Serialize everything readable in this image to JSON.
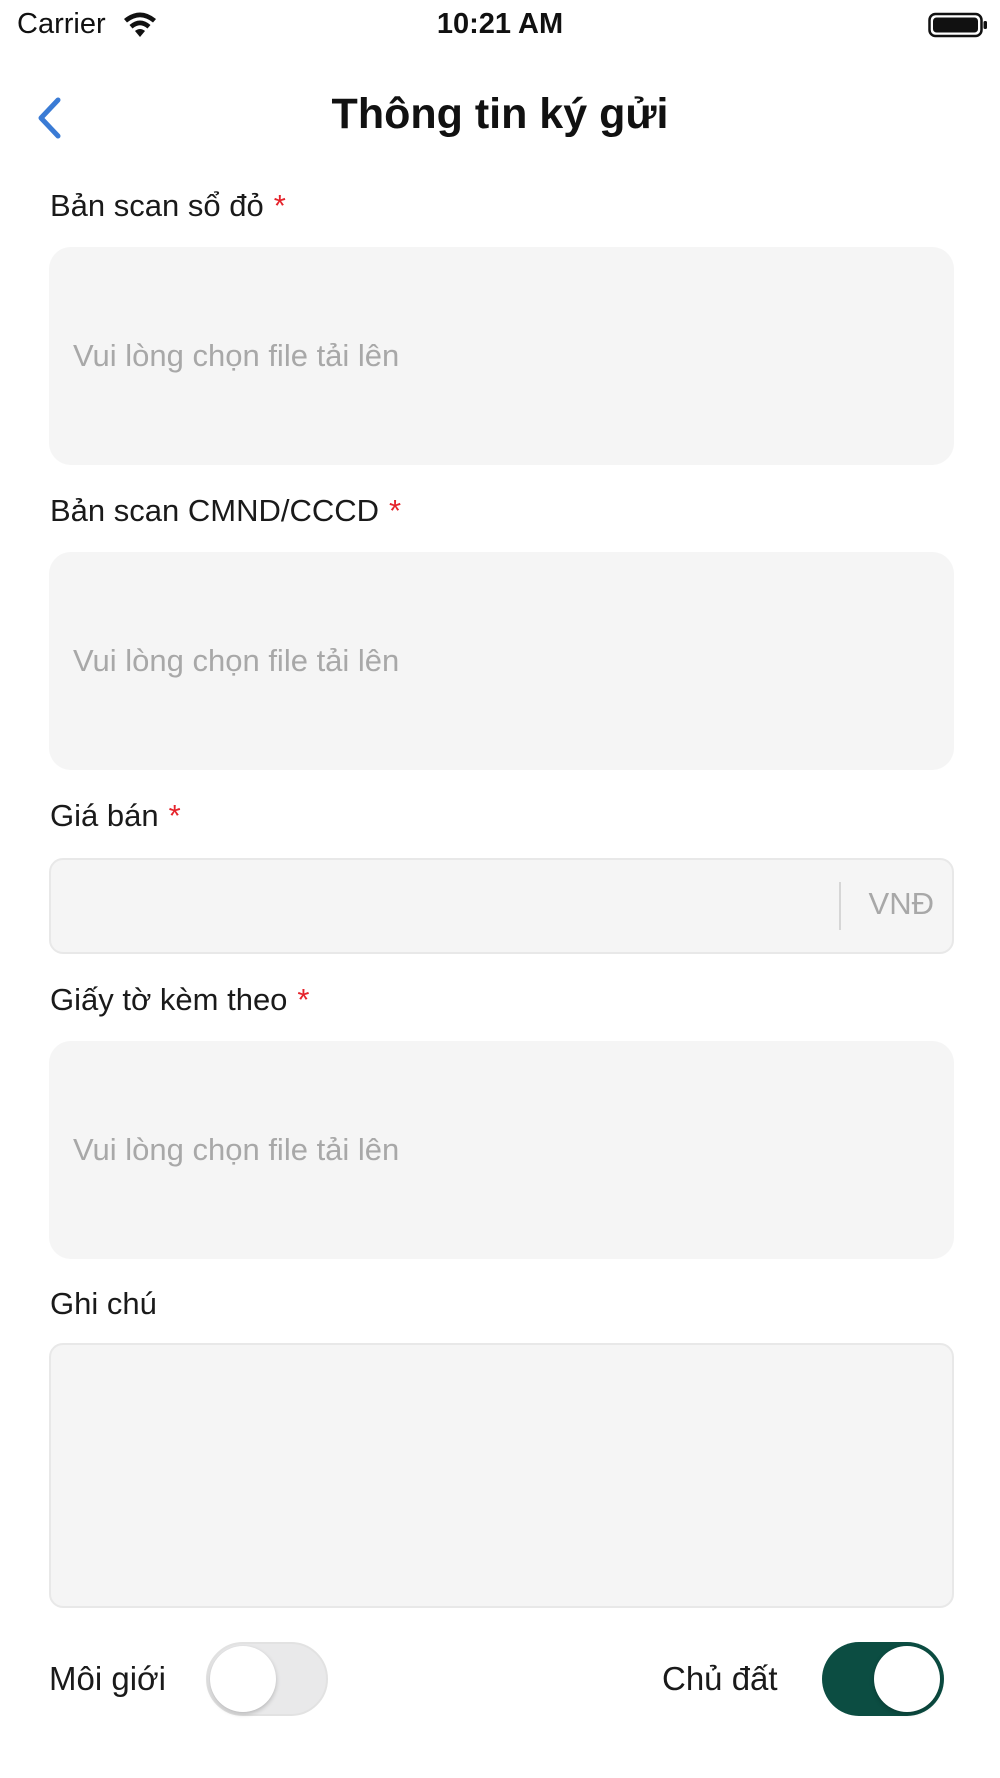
{
  "status_bar": {
    "carrier": "Carrier",
    "time": "10:21 AM"
  },
  "nav": {
    "title": "Thông tin ký gửi",
    "back_icon": "chevron-left-icon",
    "accent_color": "#3a7bd5"
  },
  "form": {
    "red_book_scan": {
      "label": "Bản scan sổ đỏ",
      "required_mark": "*",
      "placeholder": "Vui lòng chọn file tải lên"
    },
    "id_card_scan": {
      "label": "Bản scan CMND/CCCD",
      "required_mark": "*",
      "placeholder": "Vui lòng chọn file tải lên"
    },
    "price": {
      "label": "Giá bán",
      "required_mark": "*",
      "value": "",
      "unit": "VNĐ"
    },
    "attachments": {
      "label": "Giấy tờ kèm theo",
      "required_mark": "*",
      "placeholder": "Vui lòng chọn file tải lên"
    },
    "note": {
      "label": "Ghi chú",
      "value": ""
    }
  },
  "toggles": {
    "broker": {
      "label": "Môi giới",
      "on": false
    },
    "owner": {
      "label": "Chủ đất",
      "on": true,
      "color": "#0c4d42"
    }
  },
  "colors": {
    "required": "#e5232b",
    "field_bg": "#f5f5f5",
    "placeholder": "#a8a8a8"
  }
}
